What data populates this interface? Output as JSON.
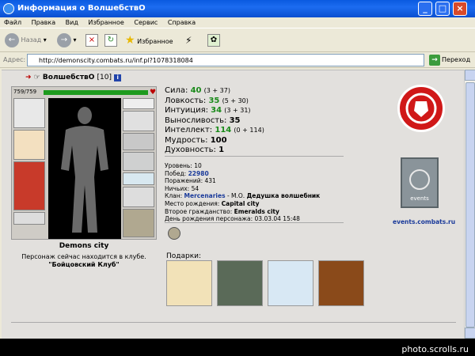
{
  "window": {
    "title": "Информация о ВолшебствО"
  },
  "menu": [
    "Файл",
    "Правка",
    "Вид",
    "Избранное",
    "Сервис",
    "Справка"
  ],
  "toolbar": {
    "back": "Назад",
    "favorites": "Избранное"
  },
  "address": {
    "label": "Адрес:",
    "url": "http://demonscity.combats.ru/inf.pl?1078318084",
    "go": "Переход"
  },
  "character": {
    "name": "ВолшебствО",
    "level": "[10]",
    "hp": "759/759",
    "hp_fraction": 1.0
  },
  "city": "Demons city",
  "club_text": "Персонаж сейчас находится в клубе.",
  "club_name": "\"Бойцовский Клуб\"",
  "stats": [
    {
      "label": "Сила:",
      "value": "40",
      "bonus": "(3 + 37)"
    },
    {
      "label": "Ловкость:",
      "value": "35",
      "bonus": "(5 + 30)"
    },
    {
      "label": "Интуиция:",
      "value": "34",
      "bonus": "(3 + 31)"
    },
    {
      "label": "Выносливость:",
      "value": "35",
      "bonus": ""
    },
    {
      "label": "Интеллект:",
      "value": "114",
      "bonus": "(0 + 114)"
    },
    {
      "label": "Мудрость:",
      "value": "100",
      "bonus": ""
    },
    {
      "label": "Духовность:",
      "value": "1",
      "bonus": ""
    }
  ],
  "details": {
    "level": "Уровень: 10",
    "wins_label": "Побед:",
    "wins": "22980",
    "losses": "Поражений: 431",
    "draws": "Ничьих: 54",
    "clan_label": "Клан:",
    "clan": "Mercenaries",
    "clan_rest": "- М.О.",
    "clan_title": "Дедушка волшебник",
    "birthplace_label": "Место рождения:",
    "birthplace": "Capital city",
    "second_label": "Второе гражданство:",
    "second": "Emeralds city",
    "birthday": "День рождения персонажа: 03.03.04 15:48"
  },
  "events_link": "events.combats.ru",
  "banner_text": "events",
  "gifts_label": "Подарки:",
  "watermark": "photo.scrolls.ru",
  "colors": {
    "hp": "#1e9a1e",
    "stat_value": "#1a8a1a",
    "link": "#1a3a9a",
    "emblem": "#d01818"
  }
}
